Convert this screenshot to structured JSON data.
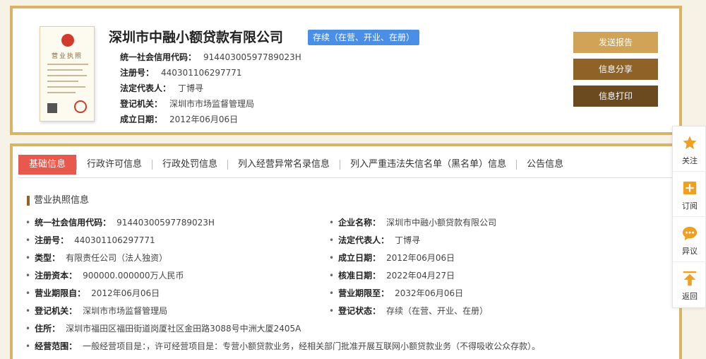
{
  "company": {
    "name": "深圳市中融小额贷款有限公司",
    "status": "存续（在营、开业、在册）"
  },
  "top_fields": [
    {
      "label": "统一社会信用代码：",
      "value": "91440300597789023H"
    },
    {
      "label": "注册号：",
      "value": "440301106297771"
    },
    {
      "label": "法定代表人：",
      "value": "丁博寻"
    },
    {
      "label": "登记机关：",
      "value": "深圳市市场监督管理局"
    },
    {
      "label": "成立日期：",
      "value": "2012年06月06日"
    }
  ],
  "license_image": {
    "title": "营业执照"
  },
  "buttons": {
    "send": "发送报告",
    "share": "信息分享",
    "print": "信息打印"
  },
  "tabs": [
    "基础信息",
    "行政许可信息",
    "行政处罚信息",
    "列入经营异常名录信息",
    "列入严重违法失信名单（黑名单）信息",
    "公告信息"
  ],
  "section_title": "营业执照信息",
  "fields_left": [
    {
      "label": "统一社会信用代码：",
      "value": "91440300597789023H"
    },
    {
      "label": "注册号：",
      "value": "440301106297771"
    },
    {
      "label": "类型：",
      "value": "有限责任公司（法人独资）"
    },
    {
      "label": "注册资本：",
      "value": "900000.000000万人民币"
    },
    {
      "label": "营业期限自：",
      "value": "2012年06月06日"
    },
    {
      "label": "登记机关：",
      "value": "深圳市市场监督管理局"
    }
  ],
  "fields_right": [
    {
      "label": "企业名称：",
      "value": "深圳市中融小额贷款有限公司"
    },
    {
      "label": "法定代表人：",
      "value": "丁博寻"
    },
    {
      "label": "成立日期：",
      "value": "2012年06月06日"
    },
    {
      "label": "核准日期：",
      "value": "2022年04月27日"
    },
    {
      "label": "营业期限至：",
      "value": "2032年06月06日"
    },
    {
      "label": "登记状态：",
      "value": "存续（在营、开业、在册）"
    }
  ],
  "address": {
    "label": "住所：",
    "value": "深圳市福田区福田街道岗厦社区金田路3088号中洲大厦2405A"
  },
  "scope": {
    "label": "经营范围：",
    "value": "一般经营项目是：，许可经营项目是：专营小额贷款业务，经相关部门批准开展互联网小额贷款业务（不得吸收公众存款）。"
  },
  "bullet": "•",
  "sidebar": [
    {
      "label": "关注",
      "icon": "star-icon"
    },
    {
      "label": "订阅",
      "icon": "subscribe-icon"
    },
    {
      "label": "异议",
      "icon": "comment-icon"
    },
    {
      "label": "返回",
      "icon": "back-top-icon"
    }
  ],
  "colors": {
    "accent": "#d9b366",
    "tab_active": "#e8584c",
    "badge": "#4a8fe7",
    "icon_orange": "#f0a020"
  }
}
